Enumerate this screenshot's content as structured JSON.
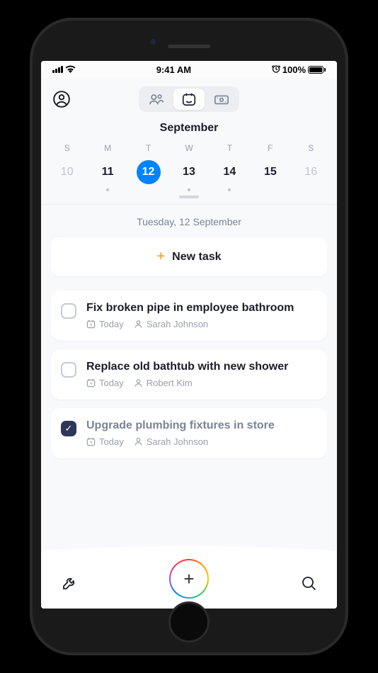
{
  "status": {
    "time": "9:41 AM",
    "battery_pct": "100%"
  },
  "tabs": {
    "people_icon": "people-icon",
    "calendar_icon": "calendar-smile-icon",
    "money_icon": "money-icon"
  },
  "calendar": {
    "month": "September",
    "selected_date_label": "Tuesday, 12 September",
    "days": [
      {
        "letter": "S",
        "num": "10",
        "muted": true,
        "dot": false
      },
      {
        "letter": "M",
        "num": "11",
        "muted": false,
        "dot": true
      },
      {
        "letter": "T",
        "num": "12",
        "muted": false,
        "dot": false,
        "selected": true
      },
      {
        "letter": "W",
        "num": "13",
        "muted": false,
        "dot": true
      },
      {
        "letter": "T",
        "num": "14",
        "muted": false,
        "dot": true
      },
      {
        "letter": "F",
        "num": "15",
        "muted": false,
        "dot": false
      },
      {
        "letter": "S",
        "num": "16",
        "muted": true,
        "dot": false
      }
    ]
  },
  "new_task_label": "New task",
  "tasks": [
    {
      "title": "Fix broken pipe in employee bathroom",
      "when": "Today",
      "assignee": "Sarah Johnson",
      "completed": false
    },
    {
      "title": "Replace old bathtub with new shower",
      "when": "Today",
      "assignee": "Robert Kim",
      "completed": false
    },
    {
      "title": "Upgrade plumbing fixtures in store",
      "when": "Today",
      "assignee": "Sarah Johnson",
      "completed": true
    }
  ]
}
